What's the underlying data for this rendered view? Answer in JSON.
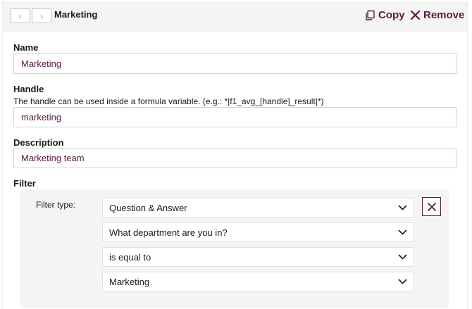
{
  "header": {
    "title": "Marketing",
    "prev_icon": "‹",
    "next_icon": "›",
    "copy_label": "Copy",
    "remove_label": "Remove"
  },
  "name": {
    "label": "Name",
    "value": "Marketing"
  },
  "handle": {
    "label": "Handle",
    "help": "The handle can be used inside a formula variable. (e.g.: *|f1_avg_[handle]_result|*)",
    "value": "marketing"
  },
  "description": {
    "label": "Description",
    "value": "Marketing team"
  },
  "filter": {
    "label": "Filter",
    "type_label": "Filter type:",
    "selects": [
      {
        "value": "Question & Answer"
      },
      {
        "value": "What department are you in?"
      },
      {
        "value": "is equal to"
      },
      {
        "value": "Marketing"
      }
    ]
  },
  "colors": {
    "accent": "#5a1a44",
    "header_bg": "#f4f4f4",
    "filter_bg": "#f4f4f4"
  }
}
